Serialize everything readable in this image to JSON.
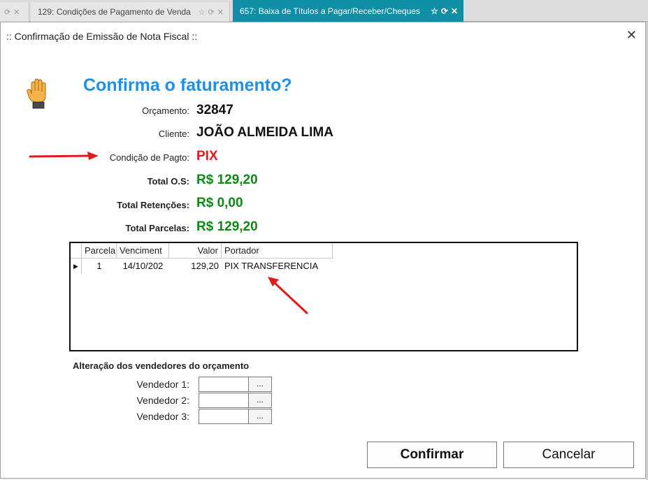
{
  "tabs": [
    {
      "label": ""
    },
    {
      "label": "129: Condições de Pagamento de Venda"
    },
    {
      "label": "657: Baixa de Títulos a Pagar/Receber/Cheques"
    }
  ],
  "dialog": {
    "title": ":: Confirmação de Emissão de Nota Fiscal ::",
    "heading": "Confirma o faturamento?",
    "fields": {
      "orcamento_label": "Orçamento:",
      "orcamento_value": "32847",
      "cliente_label": "Cliente:",
      "cliente_value": "JOÃO ALMEIDA LIMA",
      "condicao_label": "Condição de Pagto:",
      "condicao_value": "PIX",
      "total_os_label": "Total O.S:",
      "total_os_value": "R$ 129,20",
      "total_ret_label": "Total Retenções:",
      "total_ret_value": "R$ 0,00",
      "total_parc_label": "Total Parcelas:",
      "total_parc_value": "R$ 129,20"
    },
    "grid": {
      "columns": [
        "Parcela",
        "Venciment",
        "Valor",
        "Portador"
      ],
      "rows": [
        {
          "parcela": "1",
          "vencimento": "14/10/202",
          "valor": "129,20",
          "portador": "PIX TRANSFERENCIA"
        }
      ]
    },
    "vendedores": {
      "title": "Alteração dos vendedores do orçamento",
      "items": [
        {
          "label": "Vendedor 1:",
          "value": "",
          "button": "..."
        },
        {
          "label": "Vendedor 2:",
          "value": "",
          "button": "..."
        },
        {
          "label": "Vendedor 3:",
          "value": "",
          "button": "..."
        }
      ]
    },
    "buttons": {
      "confirm": "Confirmar",
      "cancel": "Cancelar"
    },
    "colors": {
      "heading": "#1e90e8",
      "pix": "#e01b1b",
      "money": "#0c8a14",
      "active_tab": "#0f8fa5",
      "annotation_arrow": "#e01b1b"
    },
    "icons": [
      "hand-stop-icon",
      "close-icon",
      "star-icon",
      "refresh-icon",
      "row-pointer-icon"
    ]
  }
}
